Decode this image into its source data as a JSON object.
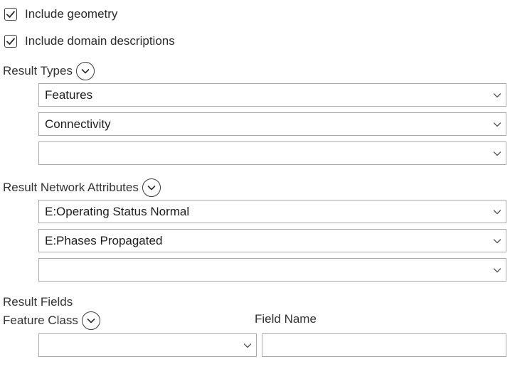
{
  "options": {
    "include_geometry": {
      "label": "Include geometry",
      "checked": true
    },
    "include_domain_descriptions": {
      "label": "Include domain descriptions",
      "checked": true
    }
  },
  "result_types": {
    "label": "Result Types",
    "values": [
      "Features",
      "Connectivity",
      ""
    ]
  },
  "result_network_attributes": {
    "label": "Result Network Attributes",
    "values": [
      "E:Operating Status Normal",
      "E:Phases Propagated",
      ""
    ]
  },
  "result_fields": {
    "label": "Result Fields",
    "feature_class_label": "Feature Class",
    "field_name_label": "Field Name",
    "feature_class_value": "",
    "field_name_value": ""
  }
}
